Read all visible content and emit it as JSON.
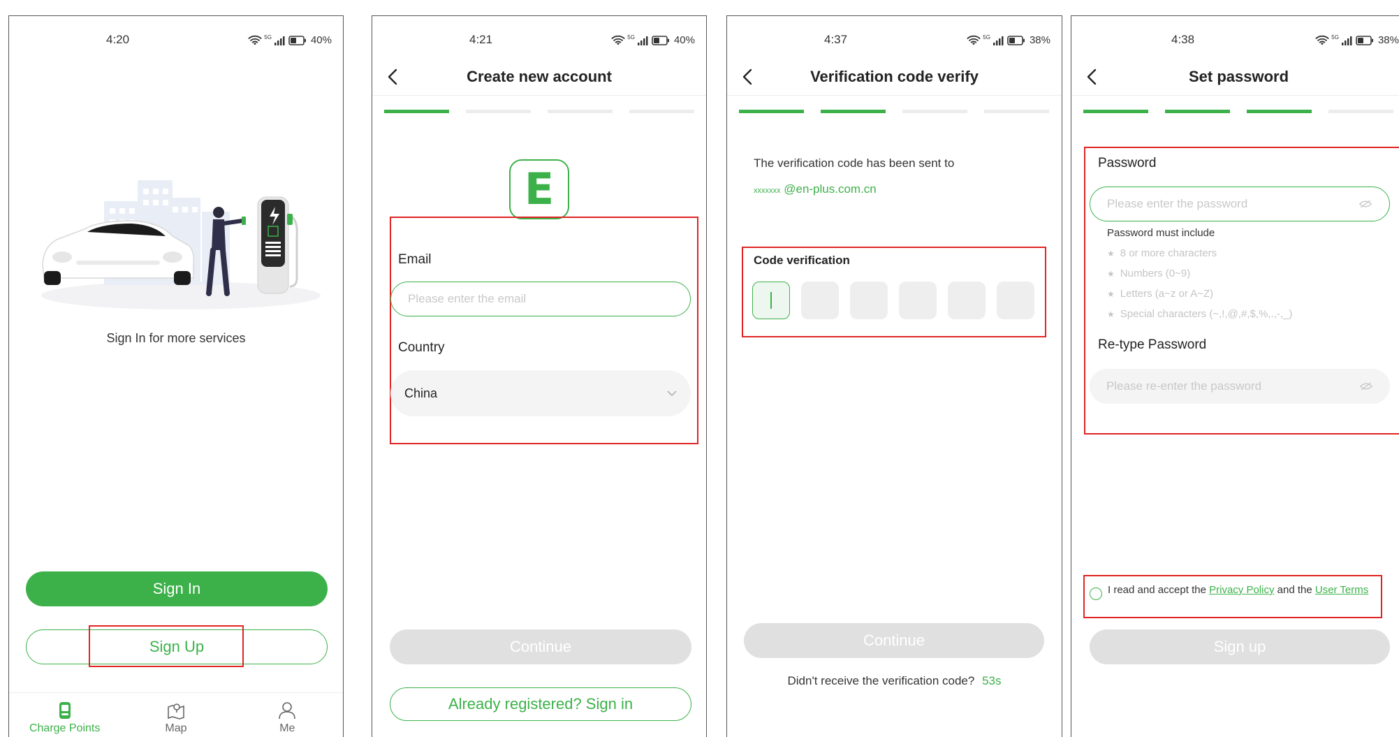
{
  "status": {
    "p1": {
      "time": "4:20",
      "battery": "40%"
    },
    "p2": {
      "time": "4:21",
      "battery": "40%"
    },
    "p3": {
      "time": "4:37",
      "battery": "38%"
    },
    "p4": {
      "time": "4:38",
      "battery": "38%"
    },
    "network": "5G"
  },
  "colors": {
    "accent": "#3cb14a",
    "annotation": "#e02424",
    "disabled": "#e0e0e0"
  },
  "screen1": {
    "tagline": "Sign In for more services",
    "sign_in_label": "Sign In",
    "sign_up_label": "Sign Up",
    "tabs": [
      {
        "label": "Charge Points",
        "icon": "charge-point-icon",
        "active": true
      },
      {
        "label": "Map",
        "icon": "map-icon",
        "active": false
      },
      {
        "label": "Me",
        "icon": "user-icon",
        "active": false
      }
    ]
  },
  "screen2": {
    "title": "Create new account",
    "progress_step": 1,
    "progress_total": 4,
    "logo_letter": "E",
    "email_label": "Email",
    "email_placeholder": "Please enter the email",
    "country_label": "Country",
    "country_value": "China",
    "continue_label": "Continue",
    "signin_link_label": "Already registered? Sign in"
  },
  "screen3": {
    "title": "Verification code verify",
    "progress_step": 2,
    "progress_total": 4,
    "sent_text": "The verification code has been sent to",
    "email_masked": "xxxxxxx",
    "email_domain": "@en-plus.com.cn",
    "code_label": "Code verification",
    "code_length": 6,
    "continue_label": "Continue",
    "resend_text": "Didn't receive the verification code?",
    "countdown": "53s"
  },
  "screen4": {
    "title": "Set password",
    "progress_step": 3,
    "progress_total": 4,
    "password_label": "Password",
    "password_placeholder": "Please enter the password",
    "rules_title": "Password must include",
    "rules": [
      "8 or more characters",
      "Numbers (0~9)",
      "Letters (a~z or A~Z)",
      "Special characters (~,!,@,#,$,%,.,-,_)"
    ],
    "retype_label": "Re-type Password",
    "retype_placeholder": "Please re-enter the password",
    "terms_prefix": "I read and accept the",
    "privacy_label": "Privacy Policy",
    "terms_and": "and the",
    "user_terms_label": "User Terms",
    "signup_label": "Sign up"
  }
}
